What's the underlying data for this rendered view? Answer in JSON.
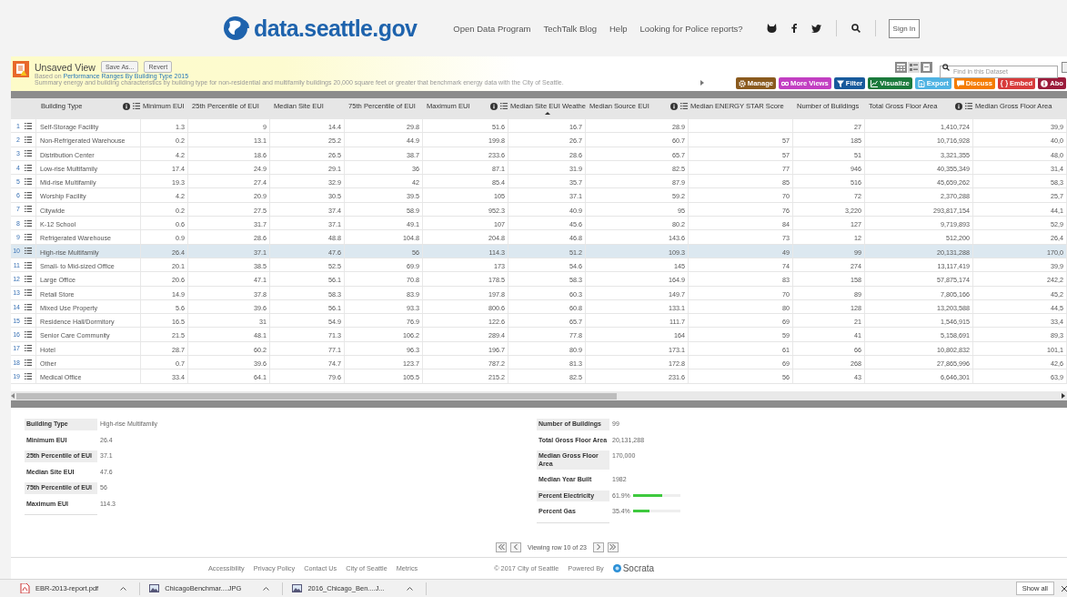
{
  "site": {
    "logo": "data.seattle.gov",
    "nav": [
      "Open Data Program",
      "TechTalk Blog",
      "Help",
      "Looking for Police reports?"
    ],
    "sign_in": "Sign In"
  },
  "view": {
    "title": "Unsaved View",
    "buttons": [
      "Save As...",
      "Revert"
    ],
    "based_on": "Based on",
    "based_on_link": "Performance Ranges By Building Type 2015",
    "description": "Summary energy and building characteristics by building type for non-residential and multifamily buildings 20,000 square feet or greater that benchmark energy data with the City of Seattle.",
    "search": {
      "placeholder": "Find in this Dataset"
    },
    "actions": [
      {
        "label": "Manage",
        "kind": "manage",
        "color": "#8a5a1e"
      },
      {
        "label": "More Views",
        "kind": "views",
        "color": "#c23fc2"
      },
      {
        "label": "Filter",
        "kind": "filter",
        "color": "#185a9c"
      },
      {
        "label": "Visualize",
        "kind": "visualize",
        "color": "#1b7a3c"
      },
      {
        "label": "Export",
        "kind": "export",
        "color": "#4fb3e3"
      },
      {
        "label": "Discuss",
        "kind": "discuss",
        "color": "#f57c00"
      },
      {
        "label": "Embed",
        "kind": "embed",
        "color": "#d83b3b"
      },
      {
        "label": "Abo",
        "kind": "about",
        "color": "#9b1b3b"
      }
    ]
  },
  "table": {
    "columns": [
      {
        "label": "Building Type",
        "info": false,
        "sorted": false
      },
      {
        "label": "Minimum EUI",
        "info": true,
        "sorted": false
      },
      {
        "label": "25th Percentile of EUI",
        "info": false,
        "sorted": false
      },
      {
        "label": "Median Site EUI",
        "info": false,
        "sorted": false
      },
      {
        "label": "75th Percentile of EUI",
        "info": false,
        "sorted": false
      },
      {
        "label": "Maximum EUI",
        "info": false,
        "sorted": false
      },
      {
        "label": "Median Site EUI Weathe",
        "info": true,
        "sorted": true
      },
      {
        "label": "Median Source EUI",
        "info": false,
        "sorted": false
      },
      {
        "label": "Median ENERGY STAR Score",
        "info": true,
        "sorted": false
      },
      {
        "label": "Number of Buildings",
        "info": false,
        "sorted": false
      },
      {
        "label": "Total Gross Floor Area",
        "info": false,
        "sorted": false
      },
      {
        "label": "Median Gross Floor Area",
        "info": true,
        "sorted": false
      }
    ],
    "rows": [
      {
        "number": "1",
        "selected": false,
        "cells": [
          "Self-Storage Facility",
          "1.3",
          "9",
          "14.4",
          "29.8",
          "51.6",
          "16.7",
          "28.9",
          null,
          "27",
          "1,410,724",
          "39,9"
        ]
      },
      {
        "number": "2",
        "selected": false,
        "cells": [
          "Non-Refrigerated Warehouse",
          "0.2",
          "13.1",
          "25.2",
          "44.9",
          "199.8",
          "26.7",
          "60.7",
          "57",
          "185",
          "10,716,928",
          "40,0"
        ]
      },
      {
        "number": "3",
        "selected": false,
        "cells": [
          "Distribution Center",
          "4.2",
          "18.6",
          "26.5",
          "38.7",
          "233.6",
          "28.6",
          "65.7",
          "57",
          "51",
          "3,321,355",
          "48,0"
        ]
      },
      {
        "number": "4",
        "selected": false,
        "cells": [
          "Low-rise Multifamily",
          "17.4",
          "24.9",
          "29.1",
          "36",
          "87.1",
          "31.9",
          "82.5",
          "77",
          "946",
          "40,355,349",
          "31,4"
        ]
      },
      {
        "number": "5",
        "selected": false,
        "cells": [
          "Mid-rise Multifamily",
          "19.3",
          "27.4",
          "32.9",
          "42",
          "85.4",
          "35.7",
          "87.9",
          "85",
          "516",
          "45,659,262",
          "58,3"
        ]
      },
      {
        "number": "6",
        "selected": false,
        "cells": [
          "Worship Facility",
          "4.2",
          "20.9",
          "30.5",
          "39.5",
          "105",
          "37.1",
          "59.2",
          "70",
          "72",
          "2,370,288",
          "25,7"
        ]
      },
      {
        "number": "7",
        "selected": false,
        "cells": [
          "Citywide",
          "0.2",
          "27.5",
          "37.4",
          "58.9",
          "952.3",
          "40.9",
          "95",
          "76",
          "3,220",
          "293,817,154",
          "44,1"
        ]
      },
      {
        "number": "8",
        "selected": false,
        "cells": [
          "K-12 School",
          "0.6",
          "31.7",
          "37.1",
          "49.1",
          "107",
          "45.6",
          "80.2",
          "84",
          "127",
          "9,719,893",
          "52,9"
        ]
      },
      {
        "number": "9",
        "selected": false,
        "cells": [
          "Refrigerated Warehouse",
          "0.9",
          "28.6",
          "48.8",
          "104.8",
          "204.8",
          "46.8",
          "143.6",
          "73",
          "12",
          "512,200",
          "26,4"
        ]
      },
      {
        "number": "10",
        "selected": true,
        "cells": [
          "High-rise Multifamily",
          "26.4",
          "37.1",
          "47.6",
          "56",
          "114.3",
          "51.2",
          "109.3",
          "49",
          "99",
          "20,131,288",
          "170,0"
        ]
      },
      {
        "number": "11",
        "selected": false,
        "cells": [
          "Small- to Mid-sized Office",
          "20.1",
          "38.5",
          "52.5",
          "69.9",
          "173",
          "54.6",
          "145",
          "74",
          "274",
          "13,117,419",
          "39,9"
        ]
      },
      {
        "number": "12",
        "selected": false,
        "cells": [
          "Large Office",
          "20.6",
          "47.1",
          "56.1",
          "70.8",
          "178.5",
          "58.3",
          "164.9",
          "83",
          "158",
          "57,875,174",
          "242,2"
        ]
      },
      {
        "number": "13",
        "selected": false,
        "cells": [
          "Retail Store",
          "14.9",
          "37.8",
          "58.3",
          "83.9",
          "197.8",
          "60.3",
          "149.7",
          "70",
          "89",
          "7,805,166",
          "45,2"
        ]
      },
      {
        "number": "14",
        "selected": false,
        "cells": [
          "Mixed Use Property",
          "5.6",
          "39.6",
          "56.1",
          "93.3",
          "800.6",
          "60.8",
          "133.1",
          "80",
          "128",
          "13,203,588",
          "44,5"
        ]
      },
      {
        "number": "15",
        "selected": false,
        "cells": [
          "Residence Hall/Dormitory",
          "16.5",
          "31",
          "54.9",
          "76.9",
          "122.6",
          "65.7",
          "111.7",
          "69",
          "21",
          "1,546,915",
          "33,4"
        ]
      },
      {
        "number": "16",
        "selected": false,
        "cells": [
          "Senior Care Community",
          "21.5",
          "48.1",
          "71.3",
          "106.2",
          "289.4",
          "77.8",
          "164",
          "59",
          "41",
          "5,158,691",
          "89,3"
        ]
      },
      {
        "number": "17",
        "selected": false,
        "cells": [
          "Hotel",
          "28.7",
          "60.2",
          "77.1",
          "96.3",
          "196.7",
          "80.9",
          "173.1",
          "61",
          "66",
          "10,802,832",
          "101,1"
        ]
      },
      {
        "number": "18",
        "selected": false,
        "cells": [
          "Other",
          "0.7",
          "39.6",
          "74.7",
          "123.7",
          "787.2",
          "81.3",
          "172.8",
          "69",
          "268",
          "27,865,996",
          "42,6"
        ]
      },
      {
        "number": "19",
        "selected": false,
        "cells": [
          "Medical Office",
          "33.4",
          "64.1",
          "79.6",
          "105.5",
          "215.2",
          "82.5",
          "231.6",
          "56",
          "43",
          "6,646,301",
          "63,9"
        ]
      }
    ]
  },
  "detail": {
    "left": [
      {
        "label": "Building Type",
        "value": "High-rise Multifamily"
      },
      {
        "label": "Minimum EUI",
        "value": "26.4"
      },
      {
        "label": "25th Percentile of EUI",
        "value": "37.1"
      },
      {
        "label": "Median Site EUI",
        "value": "47.6"
      },
      {
        "label": "75th Percentile of EUI",
        "value": "56"
      },
      {
        "label": "Maximum EUI",
        "value": "114.3"
      }
    ],
    "right": [
      {
        "label": "Number of Buildings",
        "value": "99",
        "kind": "text"
      },
      {
        "label": "Total Gross Floor Area",
        "value": "20,131,288",
        "kind": "text"
      },
      {
        "label": "Median Gross Floor Area",
        "value": "170,000",
        "kind": "text"
      },
      {
        "label": "Median Year Built",
        "value": "1982",
        "kind": "text"
      },
      {
        "label": "Percent Electricity",
        "value": "61.9%",
        "kind": "bar",
        "level": 0.62
      },
      {
        "label": "Percent Gas",
        "value": "35.4%",
        "kind": "bar",
        "level": 0.35
      }
    ]
  },
  "pager": {
    "status": "Viewing row 10 of 23"
  },
  "footer": {
    "links": [
      "Accessibility",
      "Privacy Policy",
      "Contact Us",
      "City of Seattle",
      "Metrics"
    ],
    "copyright": "© 2017 City of Seattle",
    "powered_by": "Powered By",
    "brand": "Socrata"
  },
  "downloads": {
    "files": [
      {
        "name": "EBR-2013-report.pdf",
        "kind": "pdf"
      },
      {
        "name": "ChicagoBenchmar....JPG",
        "kind": "image"
      },
      {
        "name": "2016_Chicago_Ben....J...",
        "kind": "image"
      }
    ],
    "show_all": "Show all"
  }
}
